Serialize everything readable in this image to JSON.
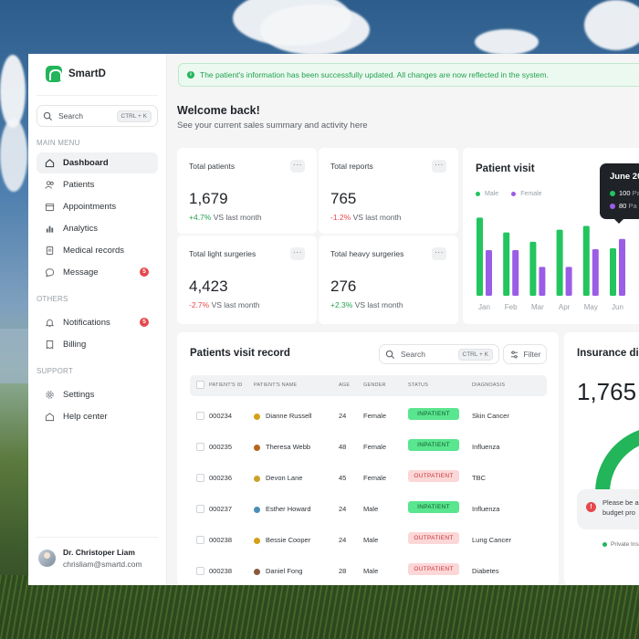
{
  "app": {
    "name": "SmartD"
  },
  "search": {
    "placeholder": "Search",
    "shortcut": "CTRL + K"
  },
  "menu_sections": {
    "main": "MAIN MENU",
    "others": "OTHERS",
    "support": "SUPPORT"
  },
  "nav": {
    "dashboard": "Dashboard",
    "patients": "Patients",
    "appointments": "Appointments",
    "analytics": "Analytics",
    "medical_records": "Medical records",
    "message": "Message",
    "message_count": "5",
    "notifications": "Notifications",
    "notifications_count": "5",
    "billing": "Billing",
    "settings": "Settings",
    "help_center": "Help center"
  },
  "profile": {
    "name": "Dr. Christoper Liam",
    "email": "chrisliam@smartd.com"
  },
  "alert": {
    "text": "The patient's information has been successfully updated. All changes are now reflected in the system."
  },
  "header": {
    "welcome": "Welcome back!",
    "subtitle": "See your current sales summary and activity here"
  },
  "stats": [
    {
      "title": "Total patients",
      "value": "1,679",
      "delta": "+4.7%",
      "trend": "up",
      "suffix": "VS last month"
    },
    {
      "title": "Total reports",
      "value": "765",
      "delta": "-1.2%",
      "trend": "down",
      "suffix": "VS last month"
    },
    {
      "title": "Total light surgeries",
      "value": "4,423",
      "delta": "-2.7%",
      "trend": "down",
      "suffix": "VS last month"
    },
    {
      "title": "Total heavy surgeries",
      "value": "276",
      "delta": "+2.3%",
      "trend": "up",
      "suffix": "VS last month"
    }
  ],
  "more_label": "···",
  "chart_data": {
    "type": "bar",
    "title": "Patient visit",
    "categories": [
      "Jan",
      "Feb",
      "Mar",
      "Apr",
      "May",
      "Jun"
    ],
    "series": [
      {
        "name": "Male",
        "color": "#22c55e",
        "values": [
          84,
          68,
          58,
          71,
          75,
          51
        ]
      },
      {
        "name": "Female",
        "color": "#9b5de5",
        "values": [
          49,
          49,
          31,
          31,
          50,
          61
        ]
      }
    ],
    "ylim": [
      0,
      100
    ],
    "tooltip": {
      "title": "June 20",
      "rows": [
        {
          "value": "100",
          "label": "Pa",
          "color": "#22c55e"
        },
        {
          "value": "80",
          "label": "Pa",
          "color": "#9b5de5"
        }
      ]
    }
  },
  "table": {
    "title": "Patients visit record",
    "search_placeholder": "Search",
    "search_shortcut": "CTRL + K",
    "filter_label": "Filter",
    "columns": [
      "PATIENT'S ID",
      "PATIENT'S NAME",
      "AGE",
      "GENDER",
      "STATUS",
      "DIAGNOASIS"
    ],
    "rows": [
      {
        "id": "000234",
        "name": "Dianne Russell",
        "age": "24",
        "gender": "Female",
        "status": "INPATIENT",
        "kind": "in",
        "diagnosis": "Skin Cancer",
        "avatar": "#d4a017"
      },
      {
        "id": "000235",
        "name": "Theresa Webb",
        "age": "48",
        "gender": "Female",
        "status": "INPATIENT",
        "kind": "in",
        "diagnosis": "Influenza",
        "avatar": "#b5651d"
      },
      {
        "id": "000236",
        "name": "Devon Lane",
        "age": "45",
        "gender": "Female",
        "status": "OUTPATIENT",
        "kind": "out",
        "diagnosis": "TBC",
        "avatar": "#c9a227"
      },
      {
        "id": "000237",
        "name": "Esther Howard",
        "age": "24",
        "gender": "Male",
        "status": "INPATIENT",
        "kind": "in",
        "diagnosis": "Influenza",
        "avatar": "#4a8fb5"
      },
      {
        "id": "000238",
        "name": "Bessie Cooper",
        "age": "24",
        "gender": "Male",
        "status": "OUTPATIENT",
        "kind": "out",
        "diagnosis": "Lung Cancer",
        "avatar": "#d4a017"
      },
      {
        "id": "000238",
        "name": "Daniel Fong",
        "age": "28",
        "gender": "Male",
        "status": "OUTPATIENT",
        "kind": "out",
        "diagnosis": "Diabetes",
        "avatar": "#8a5a3b"
      }
    ]
  },
  "insurance": {
    "title": "Insurance dis",
    "value": "1,765",
    "gauge_color": "#22b55a",
    "note_line1": "Please be a",
    "note_line2": "budget pro",
    "legend": "Private Ins"
  }
}
